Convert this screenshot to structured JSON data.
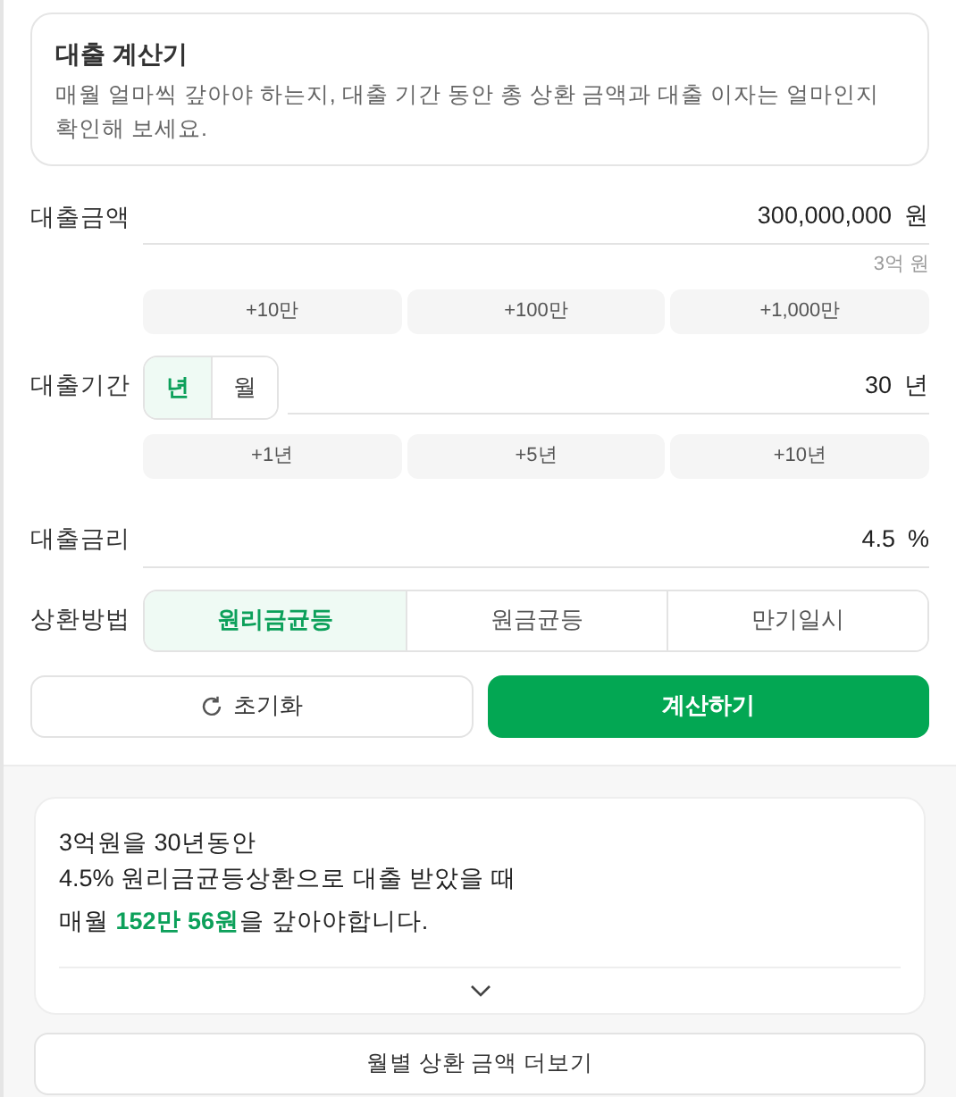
{
  "header": {
    "title": "대출 계산기",
    "description": "매월 얼마씩 갚아야 하는지, 대출 기간 동안 총 상환 금액과 대출 이자는 얼마인지 확인해 보세요."
  },
  "amount": {
    "label": "대출금액",
    "value": "300,000,000",
    "unit": "원",
    "hint": "3억 원",
    "quick_buttons": [
      "+10만",
      "+100만",
      "+1,000만"
    ]
  },
  "period": {
    "label": "대출기간",
    "units": [
      {
        "label": "년",
        "selected": true
      },
      {
        "label": "월",
        "selected": false
      }
    ],
    "value": "30",
    "unit": "년",
    "quick_buttons": [
      "+1년",
      "+5년",
      "+10년"
    ]
  },
  "rate": {
    "label": "대출금리",
    "value": "4.5",
    "unit": "%"
  },
  "method": {
    "label": "상환방법",
    "options": [
      {
        "label": "원리금균등",
        "selected": true
      },
      {
        "label": "원금균등",
        "selected": false
      },
      {
        "label": "만기일시",
        "selected": false
      }
    ]
  },
  "actions": {
    "reset": "초기화",
    "calculate": "계산하기"
  },
  "result": {
    "lines": [
      "3억원을 30년동안",
      "4.5% 원리금균등상환으로 대출 받았을 때"
    ],
    "summary": "매월 **152만 56원**을 갚아야합니다."
  },
  "more_button": "월별 상환 금액 더보기"
}
